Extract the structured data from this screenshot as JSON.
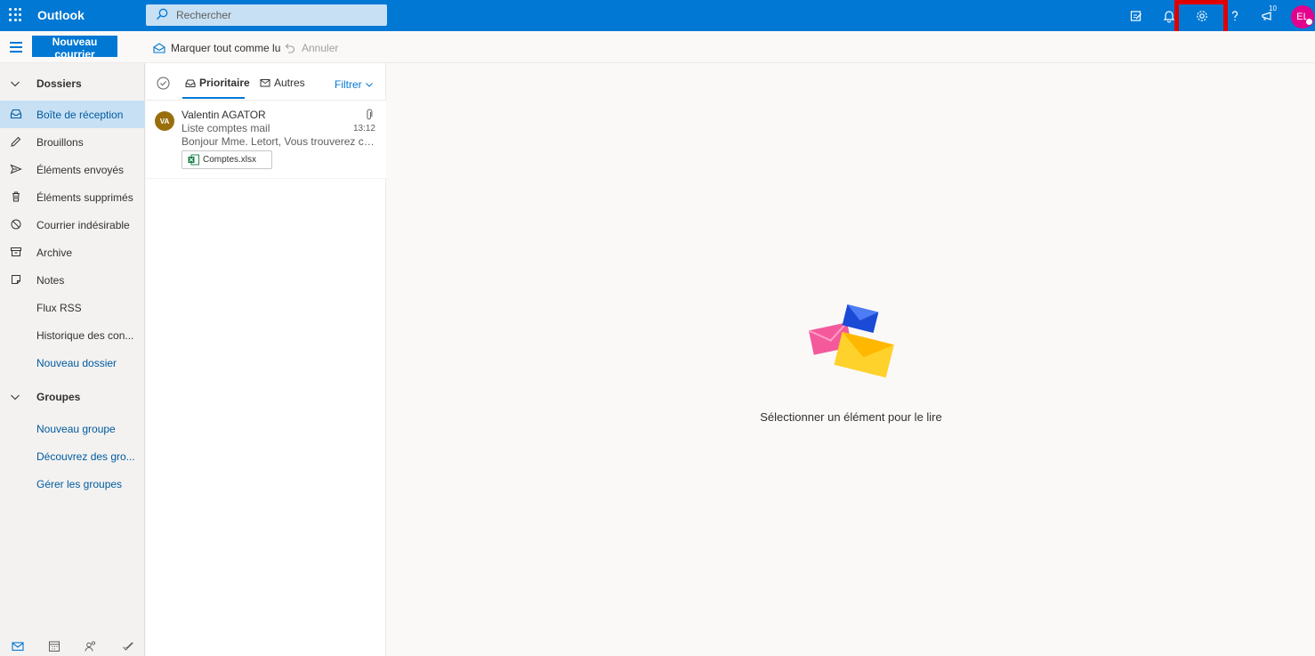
{
  "app": {
    "title": "Outlook"
  },
  "search": {
    "placeholder": "Rechercher"
  },
  "header": {
    "notification_badge": "10",
    "user_initials": "EL"
  },
  "commands": {
    "new_mail": "Nouveau courrier",
    "mark_all_read": "Marquer tout comme lu",
    "undo": "Annuler"
  },
  "nav": {
    "folders_heading": "Dossiers",
    "folders": [
      {
        "label": "Boîte de réception",
        "icon": "inbox-icon",
        "selected": true
      },
      {
        "label": "Brouillons",
        "icon": "pencil-icon"
      },
      {
        "label": "Éléments envoyés",
        "icon": "send-icon"
      },
      {
        "label": "Éléments supprimés",
        "icon": "trash-icon"
      },
      {
        "label": "Courrier indésirable",
        "icon": "block-icon"
      },
      {
        "label": "Archive",
        "icon": "archive-icon"
      },
      {
        "label": "Notes",
        "icon": "note-icon"
      },
      {
        "label": "Flux RSS"
      },
      {
        "label": "Historique des con..."
      },
      {
        "label": "Nouveau dossier",
        "link": true
      }
    ],
    "groups_heading": "Groupes",
    "groups": [
      {
        "label": "Nouveau groupe"
      },
      {
        "label": "Découvrez des gro..."
      },
      {
        "label": "Gérer les groupes"
      }
    ]
  },
  "list": {
    "tabs": [
      {
        "label": "Prioritaire",
        "active": true
      },
      {
        "label": "Autres"
      }
    ],
    "filter": "Filtrer",
    "messages": [
      {
        "initials": "VA",
        "sender": "Valentin AGATOR",
        "subject": "Liste comptes mail",
        "preview": "Bonjour Mme. Letort, Vous trouverez ci-joint la liste des comptes mail",
        "time": "13:12",
        "attachment": "Comptes.xlsx"
      }
    ]
  },
  "reading": {
    "empty_text": "Sélectionner un élément pour le lire"
  },
  "colors": {
    "accent": "#0078d4",
    "highlight": "#e00000",
    "avatar_user": "#e3008c",
    "avatar_sender": "#986f0b"
  }
}
